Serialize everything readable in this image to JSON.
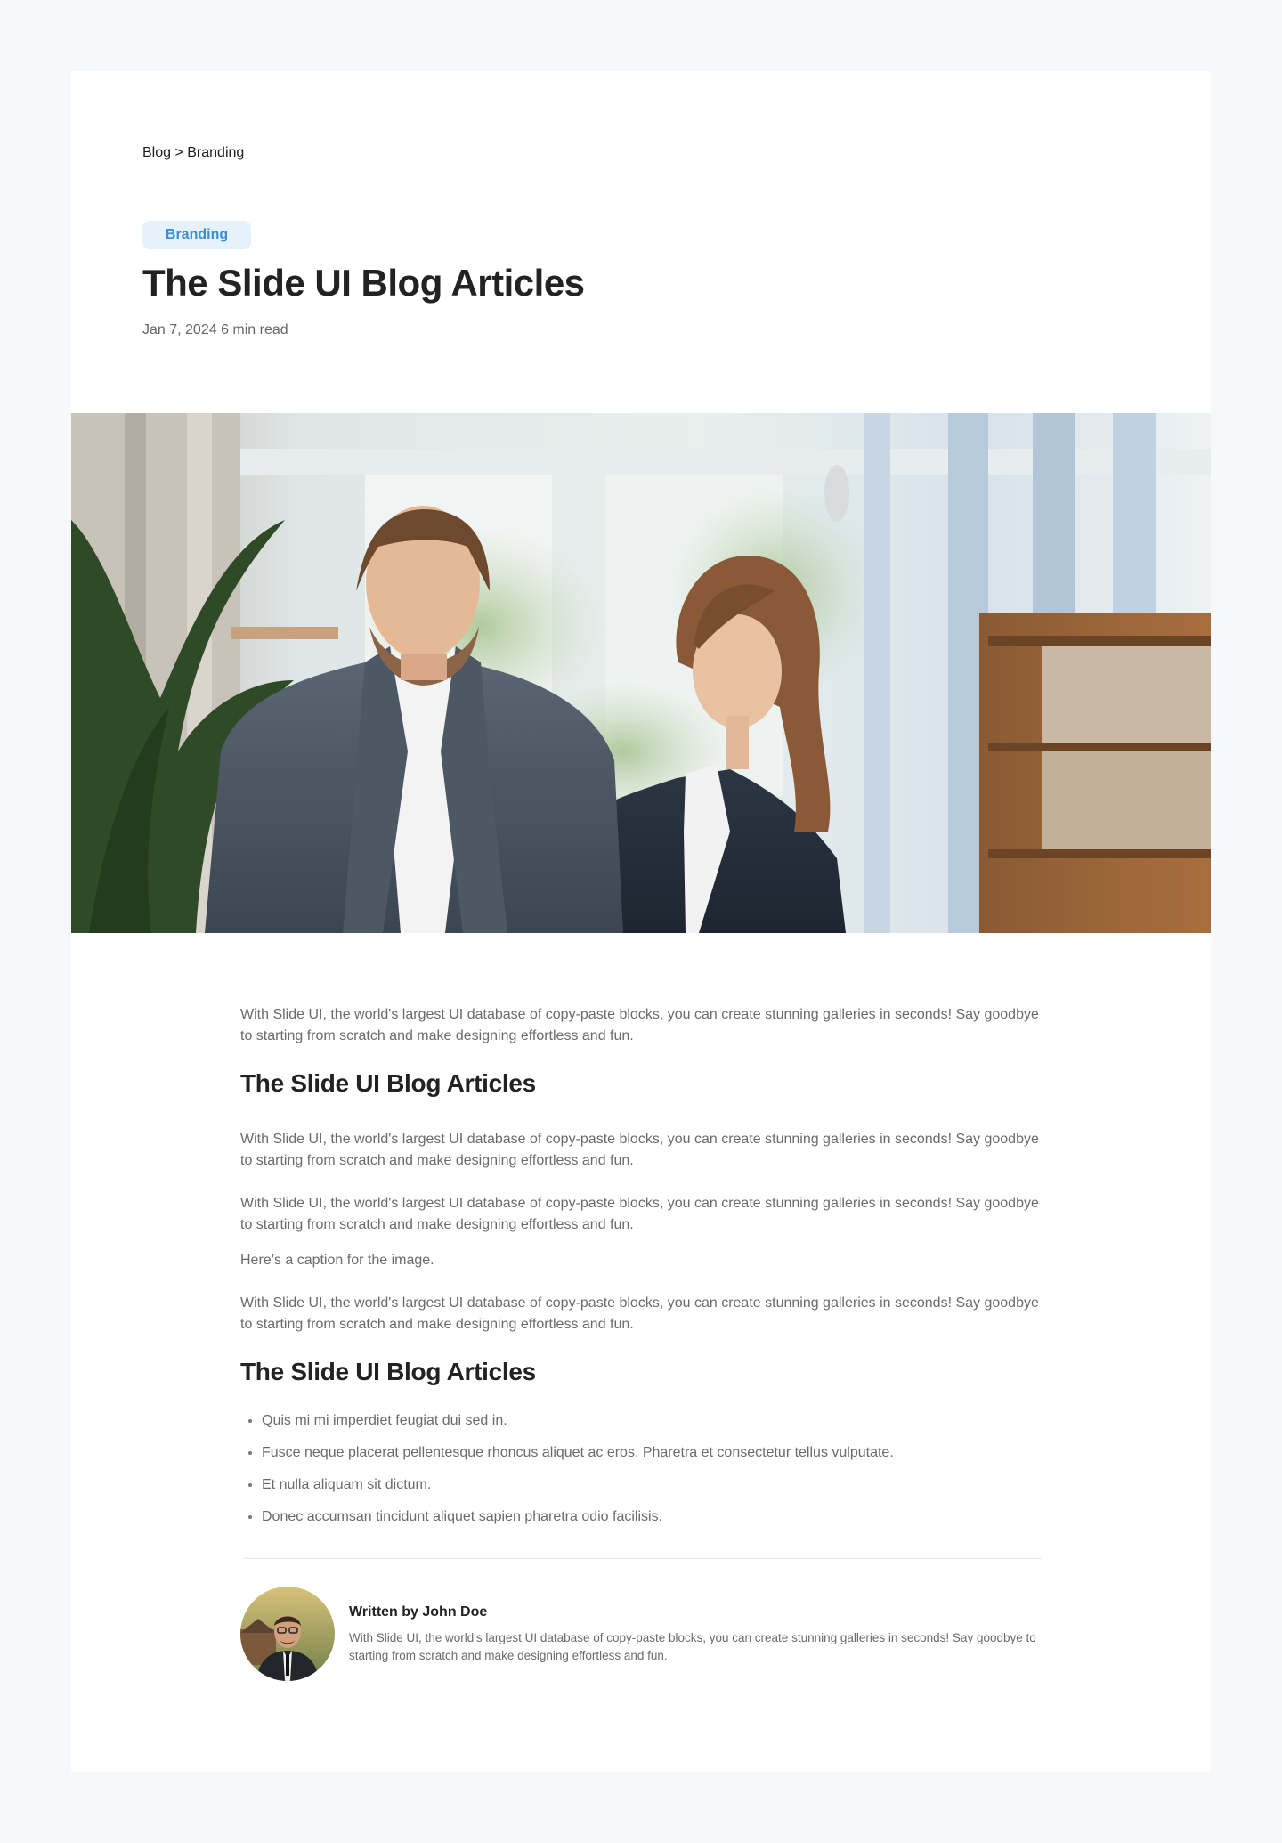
{
  "breadcrumb": "Blog > Branding",
  "tag": "Branding",
  "title": "The Slide UI Blog Articles",
  "meta": "Jan 7, 2024 6 min read",
  "body": {
    "intro": "With Slide UI, the world's largest UI database of copy-paste blocks, you can create stunning galleries in seconds! Say goodbye to starting from scratch and make designing effortless and fun.",
    "heading1": "The Slide UI Blog Articles",
    "para2": "With Slide UI, the world's largest UI database of copy-paste blocks, you can create stunning galleries in seconds! Say goodbye to starting from scratch and make designing effortless and fun.",
    "para3": "With Slide UI, the world's largest UI database of copy-paste blocks, you can create stunning galleries in seconds! Say goodbye to starting from scratch and make designing effortless and fun.",
    "caption": "Here’s a caption for the image.",
    "para4": "With Slide UI, the world's largest UI database of copy-paste blocks, you can create stunning galleries in seconds! Say goodbye to starting from scratch and make designing effortless and fun.",
    "heading2": "The Slide UI Blog Articles",
    "list": [
      "Quis mi mi imperdiet feugiat dui sed in.",
      "Fusce neque placerat pellentesque rhoncus aliquet ac eros. Pharetra et consectetur tellus vulputate.",
      "Et nulla aliquam sit dictum.",
      "Donec accumsan tincidunt aliquet sapien pharetra odio facilisis."
    ]
  },
  "author": {
    "name": "Written by John Doe",
    "bio": "With Slide UI, the world's largest UI database of copy-paste blocks, you can create stunning galleries in seconds! Say goodbye to starting from scratch and make designing effortless and fun."
  },
  "colors": {
    "page_bg": "#f7f8fa",
    "tag_bg": "#e5f2fc",
    "tag_text": "#3b8fd0",
    "body_text": "#6b6b6b",
    "heading_text": "#222222"
  }
}
